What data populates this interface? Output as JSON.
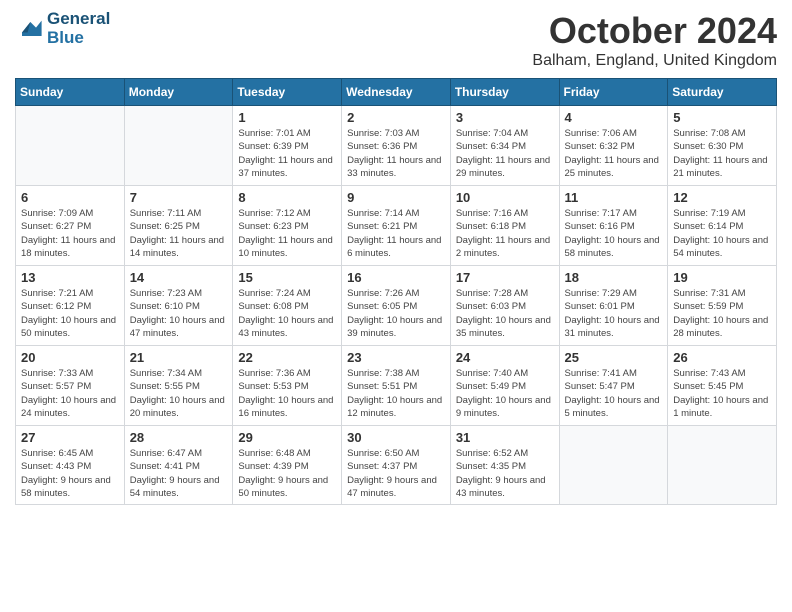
{
  "header": {
    "logo_line1": "General",
    "logo_line2": "Blue",
    "month": "October 2024",
    "location": "Balham, England, United Kingdom"
  },
  "weekdays": [
    "Sunday",
    "Monday",
    "Tuesday",
    "Wednesday",
    "Thursday",
    "Friday",
    "Saturday"
  ],
  "weeks": [
    [
      {
        "day": "",
        "detail": ""
      },
      {
        "day": "",
        "detail": ""
      },
      {
        "day": "1",
        "detail": "Sunrise: 7:01 AM\nSunset: 6:39 PM\nDaylight: 11 hours and 37 minutes."
      },
      {
        "day": "2",
        "detail": "Sunrise: 7:03 AM\nSunset: 6:36 PM\nDaylight: 11 hours and 33 minutes."
      },
      {
        "day": "3",
        "detail": "Sunrise: 7:04 AM\nSunset: 6:34 PM\nDaylight: 11 hours and 29 minutes."
      },
      {
        "day": "4",
        "detail": "Sunrise: 7:06 AM\nSunset: 6:32 PM\nDaylight: 11 hours and 25 minutes."
      },
      {
        "day": "5",
        "detail": "Sunrise: 7:08 AM\nSunset: 6:30 PM\nDaylight: 11 hours and 21 minutes."
      }
    ],
    [
      {
        "day": "6",
        "detail": "Sunrise: 7:09 AM\nSunset: 6:27 PM\nDaylight: 11 hours and 18 minutes."
      },
      {
        "day": "7",
        "detail": "Sunrise: 7:11 AM\nSunset: 6:25 PM\nDaylight: 11 hours and 14 minutes."
      },
      {
        "day": "8",
        "detail": "Sunrise: 7:12 AM\nSunset: 6:23 PM\nDaylight: 11 hours and 10 minutes."
      },
      {
        "day": "9",
        "detail": "Sunrise: 7:14 AM\nSunset: 6:21 PM\nDaylight: 11 hours and 6 minutes."
      },
      {
        "day": "10",
        "detail": "Sunrise: 7:16 AM\nSunset: 6:18 PM\nDaylight: 11 hours and 2 minutes."
      },
      {
        "day": "11",
        "detail": "Sunrise: 7:17 AM\nSunset: 6:16 PM\nDaylight: 10 hours and 58 minutes."
      },
      {
        "day": "12",
        "detail": "Sunrise: 7:19 AM\nSunset: 6:14 PM\nDaylight: 10 hours and 54 minutes."
      }
    ],
    [
      {
        "day": "13",
        "detail": "Sunrise: 7:21 AM\nSunset: 6:12 PM\nDaylight: 10 hours and 50 minutes."
      },
      {
        "day": "14",
        "detail": "Sunrise: 7:23 AM\nSunset: 6:10 PM\nDaylight: 10 hours and 47 minutes."
      },
      {
        "day": "15",
        "detail": "Sunrise: 7:24 AM\nSunset: 6:08 PM\nDaylight: 10 hours and 43 minutes."
      },
      {
        "day": "16",
        "detail": "Sunrise: 7:26 AM\nSunset: 6:05 PM\nDaylight: 10 hours and 39 minutes."
      },
      {
        "day": "17",
        "detail": "Sunrise: 7:28 AM\nSunset: 6:03 PM\nDaylight: 10 hours and 35 minutes."
      },
      {
        "day": "18",
        "detail": "Sunrise: 7:29 AM\nSunset: 6:01 PM\nDaylight: 10 hours and 31 minutes."
      },
      {
        "day": "19",
        "detail": "Sunrise: 7:31 AM\nSunset: 5:59 PM\nDaylight: 10 hours and 28 minutes."
      }
    ],
    [
      {
        "day": "20",
        "detail": "Sunrise: 7:33 AM\nSunset: 5:57 PM\nDaylight: 10 hours and 24 minutes."
      },
      {
        "day": "21",
        "detail": "Sunrise: 7:34 AM\nSunset: 5:55 PM\nDaylight: 10 hours and 20 minutes."
      },
      {
        "day": "22",
        "detail": "Sunrise: 7:36 AM\nSunset: 5:53 PM\nDaylight: 10 hours and 16 minutes."
      },
      {
        "day": "23",
        "detail": "Sunrise: 7:38 AM\nSunset: 5:51 PM\nDaylight: 10 hours and 12 minutes."
      },
      {
        "day": "24",
        "detail": "Sunrise: 7:40 AM\nSunset: 5:49 PM\nDaylight: 10 hours and 9 minutes."
      },
      {
        "day": "25",
        "detail": "Sunrise: 7:41 AM\nSunset: 5:47 PM\nDaylight: 10 hours and 5 minutes."
      },
      {
        "day": "26",
        "detail": "Sunrise: 7:43 AM\nSunset: 5:45 PM\nDaylight: 10 hours and 1 minute."
      }
    ],
    [
      {
        "day": "27",
        "detail": "Sunrise: 6:45 AM\nSunset: 4:43 PM\nDaylight: 9 hours and 58 minutes."
      },
      {
        "day": "28",
        "detail": "Sunrise: 6:47 AM\nSunset: 4:41 PM\nDaylight: 9 hours and 54 minutes."
      },
      {
        "day": "29",
        "detail": "Sunrise: 6:48 AM\nSunset: 4:39 PM\nDaylight: 9 hours and 50 minutes."
      },
      {
        "day": "30",
        "detail": "Sunrise: 6:50 AM\nSunset: 4:37 PM\nDaylight: 9 hours and 47 minutes."
      },
      {
        "day": "31",
        "detail": "Sunrise: 6:52 AM\nSunset: 4:35 PM\nDaylight: 9 hours and 43 minutes."
      },
      {
        "day": "",
        "detail": ""
      },
      {
        "day": "",
        "detail": ""
      }
    ]
  ]
}
